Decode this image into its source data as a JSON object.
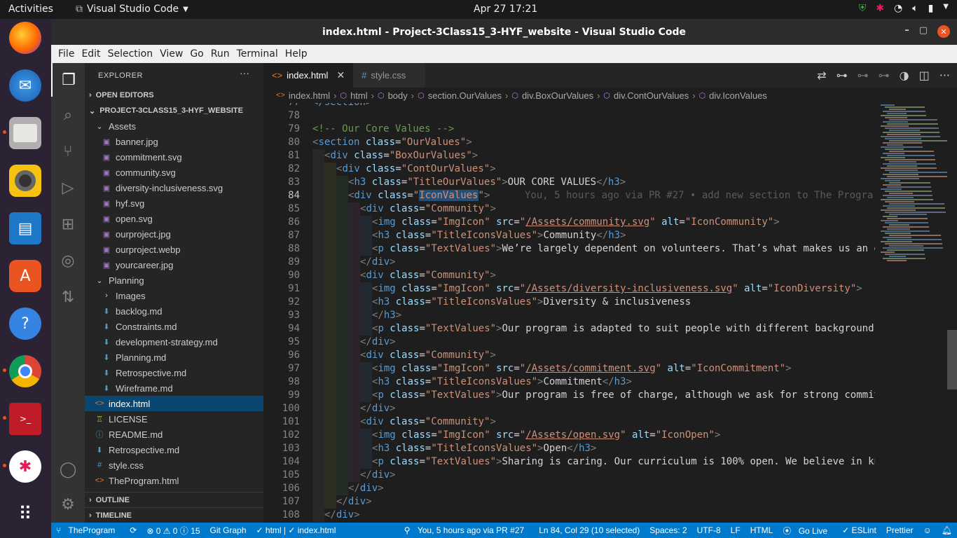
{
  "topbar": {
    "activities": "Activities",
    "app_name": "Visual Studio Code",
    "clock": "Apr 27  17:21"
  },
  "window": {
    "title": "index.html - Project-3Class15_3-HYF_website - Visual Studio Code"
  },
  "menu": [
    "File",
    "Edit",
    "Selection",
    "View",
    "Go",
    "Run",
    "Terminal",
    "Help"
  ],
  "sidebar": {
    "title": "EXPLORER",
    "open_editors": "OPEN EDITORS",
    "project": "PROJECT-3CLASS15_3-HYF_WEBSITE",
    "tree": [
      {
        "label": "Assets",
        "type": "folder",
        "depth": 1
      },
      {
        "label": "banner.jpg",
        "type": "img",
        "depth": 2
      },
      {
        "label": "commitment.svg",
        "type": "img",
        "depth": 2
      },
      {
        "label": "community.svg",
        "type": "img",
        "depth": 2
      },
      {
        "label": "diversity-inclusiveness.svg",
        "type": "img",
        "depth": 2
      },
      {
        "label": "hyf.svg",
        "type": "img",
        "depth": 2
      },
      {
        "label": "open.svg",
        "type": "img",
        "depth": 2
      },
      {
        "label": "ourproject.jpg",
        "type": "img",
        "depth": 2
      },
      {
        "label": "ourproject.webp",
        "type": "img",
        "depth": 2
      },
      {
        "label": "yourcareer.jpg",
        "type": "img",
        "depth": 2
      },
      {
        "label": "Planning",
        "type": "folder",
        "depth": 1
      },
      {
        "label": "Images",
        "type": "folder-closed",
        "depth": 2
      },
      {
        "label": "backlog.md",
        "type": "md",
        "depth": 2
      },
      {
        "label": "Constraints.md",
        "type": "md",
        "depth": 2
      },
      {
        "label": "development-strategy.md",
        "type": "md",
        "depth": 2
      },
      {
        "label": "Planning.md",
        "type": "md",
        "depth": 2
      },
      {
        "label": "Retrospective.md",
        "type": "md",
        "depth": 2
      },
      {
        "label": "Wireframe.md",
        "type": "md",
        "depth": 2
      },
      {
        "label": "index.html",
        "type": "html",
        "depth": 1,
        "selected": true
      },
      {
        "label": "LICENSE",
        "type": "lic",
        "depth": 1
      },
      {
        "label": "README.md",
        "type": "info",
        "depth": 1
      },
      {
        "label": "Retrospective.md",
        "type": "md",
        "depth": 1
      },
      {
        "label": "style.css",
        "type": "css",
        "depth": 1
      },
      {
        "label": "TheProgram.html",
        "type": "html",
        "depth": 1
      }
    ],
    "outline": "OUTLINE",
    "timeline": "TIMELINE"
  },
  "tabs": [
    {
      "label": "index.html",
      "active": true
    },
    {
      "label": "style.css",
      "active": false
    }
  ],
  "breadcrumb": [
    "index.html",
    "html",
    "body",
    "section.OurValues",
    "div.BoxOurValues",
    "div.ContOurValues",
    "div.IconValues"
  ],
  "editor": {
    "current_line": 84,
    "blame": "You, 5 hours ago via PR #27 • add new section to The Progra",
    "lines": [
      {
        "n": "77",
        "indent": 0,
        "html": "<span class='tg'>&lt;/section&gt;</span>"
      },
      {
        "n": "78",
        "indent": 0,
        "html": ""
      },
      {
        "n": "79",
        "indent": 0,
        "html": "<span class='cm'>&lt;!-- Our Core Values --&gt;</span>"
      },
      {
        "n": "80",
        "indent": 0,
        "html": "<span class='t'>&lt;</span><span class='tg'>section</span> <span class='at'>class</span><span class='tx'>=</span><span class='st'>\"OurValues\"</span><span class='t'>&gt;</span>"
      },
      {
        "n": "81",
        "indent": 1,
        "html": "<span class='t'>&lt;</span><span class='tg'>div</span> <span class='at'>class</span><span class='tx'>=</span><span class='st'>\"BoxOurValues\"</span><span class='t'>&gt;</span>"
      },
      {
        "n": "82",
        "indent": 2,
        "html": "<span class='t'>&lt;</span><span class='tg'>div</span> <span class='at'>class</span><span class='tx'>=</span><span class='st'>\"ContOurValues\"</span><span class='t'>&gt;</span>"
      },
      {
        "n": "83",
        "indent": 3,
        "html": "<span class='t'>&lt;</span><span class='tg'>h3</span> <span class='at'>class</span><span class='tx'>=</span><span class='st'>\"TitleOurValues\"</span><span class='t'>&gt;</span><span class='tx'>OUR CORE VALUES</span><span class='t'>&lt;/</span><span class='tg'>h3</span><span class='t'>&gt;</span>"
      },
      {
        "n": "84",
        "indent": 3,
        "html": "<span class='t'>&lt;</span><span class='tg'>div</span> <span class='at'>class</span><span class='tx'>=</span><span class='st'>\"<span class='sel'>IconValues</span>\"</span><span class='t'>&gt;</span>"
      },
      {
        "n": "85",
        "indent": 4,
        "html": "<span class='t'>&lt;</span><span class='tg'>div</span> <span class='at'>class</span><span class='tx'>=</span><span class='st'>\"Community\"</span><span class='t'>&gt;</span>"
      },
      {
        "n": "86",
        "indent": 5,
        "html": "<span class='t'>&lt;</span><span class='tg'>img</span> <span class='at'>class</span><span class='tx'>=</span><span class='st'>\"ImgIcon\"</span> <span class='at'>src</span><span class='tx'>=</span><span class='st'>\"<span class='ul'>/Assets/community.svg</span>\"</span> <span class='at'>alt</span><span class='tx'>=</span><span class='st'>\"IconCommunity\"</span><span class='t'>&gt;</span>"
      },
      {
        "n": "87",
        "indent": 5,
        "html": "<span class='t'>&lt;</span><span class='tg'>h3</span> <span class='at'>class</span><span class='tx'>=</span><span class='st'>\"TitleIconsValues\"</span><span class='t'>&gt;</span><span class='tx'>Community</span><span class='t'>&lt;/</span><span class='tg'>h3</span><span class='t'>&gt;</span>"
      },
      {
        "n": "88",
        "indent": 5,
        "html": "<span class='t'>&lt;</span><span class='tg'>p</span> <span class='at'>class</span><span class='tx'>=</span><span class='st'>\"TextValues\"</span><span class='t'>&gt;</span><span class='tx'>We’re largely dependent on volunteers. That’s what makes us an e</span>"
      },
      {
        "n": "89",
        "indent": 4,
        "html": "<span class='t'>&lt;/</span><span class='tg'>div</span><span class='t'>&gt;</span>"
      },
      {
        "n": "90",
        "indent": 4,
        "html": "<span class='t'>&lt;</span><span class='tg'>div</span> <span class='at'>class</span><span class='tx'>=</span><span class='st'>\"Community\"</span><span class='t'>&gt;</span>"
      },
      {
        "n": "91",
        "indent": 5,
        "html": "<span class='t'>&lt;</span><span class='tg'>img</span> <span class='at'>class</span><span class='tx'>=</span><span class='st'>\"ImgIcon\"</span> <span class='at'>src</span><span class='tx'>=</span><span class='st'>\"<span class='ul'>/Assets/diversity-inclusiveness.svg</span>\"</span> <span class='at'>alt</span><span class='tx'>=</span><span class='st'>\"IconDiversity\"</span><span class='t'>&gt;</span>"
      },
      {
        "n": "92",
        "indent": 5,
        "html": "<span class='t'>&lt;</span><span class='tg'>h3</span> <span class='at'>class</span><span class='tx'>=</span><span class='st'>\"TitleIconsValues\"</span><span class='t'>&gt;</span><span class='tx'>Diversity &amp; inclusiveness</span>"
      },
      {
        "n": "93",
        "indent": 5,
        "html": "<span class='t'>&lt;/</span><span class='tg'>h3</span><span class='t'>&gt;</span>"
      },
      {
        "n": "94",
        "indent": 5,
        "html": "<span class='t'>&lt;</span><span class='tg'>p</span> <span class='at'>class</span><span class='tx'>=</span><span class='st'>\"TextValues\"</span><span class='t'>&gt;</span><span class='tx'>Our program is adapted to suit people with different backgrounds</span>"
      },
      {
        "n": "95",
        "indent": 4,
        "html": "<span class='t'>&lt;/</span><span class='tg'>div</span><span class='t'>&gt;</span>"
      },
      {
        "n": "96",
        "indent": 4,
        "html": "<span class='t'>&lt;</span><span class='tg'>div</span> <span class='at'>class</span><span class='tx'>=</span><span class='st'>\"Community\"</span><span class='t'>&gt;</span>"
      },
      {
        "n": "97",
        "indent": 5,
        "html": "<span class='t'>&lt;</span><span class='tg'>img</span> <span class='at'>class</span><span class='tx'>=</span><span class='st'>\"ImgIcon\"</span> <span class='at'>src</span><span class='tx'>=</span><span class='st'>\"<span class='ul'>/Assets/commitment.svg</span>\"</span> <span class='at'>alt</span><span class='tx'>=</span><span class='st'>\"IconCommitment\"</span><span class='t'>&gt;</span>"
      },
      {
        "n": "98",
        "indent": 5,
        "html": "<span class='t'>&lt;</span><span class='tg'>h3</span> <span class='at'>class</span><span class='tx'>=</span><span class='st'>\"TitleIconsValues\"</span><span class='t'>&gt;</span><span class='tx'>Commitment</span><span class='t'>&lt;/</span><span class='tg'>h3</span><span class='t'>&gt;</span>"
      },
      {
        "n": "99",
        "indent": 5,
        "html": "<span class='t'>&lt;</span><span class='tg'>p</span> <span class='at'>class</span><span class='tx'>=</span><span class='st'>\"TextValues\"</span><span class='t'>&gt;</span><span class='tx'>Our program is free of charge, although we ask for strong commit</span>"
      },
      {
        "n": "100",
        "indent": 4,
        "html": "<span class='t'>&lt;/</span><span class='tg'>div</span><span class='t'>&gt;</span>"
      },
      {
        "n": "101",
        "indent": 4,
        "html": "<span class='t'>&lt;</span><span class='tg'>div</span> <span class='at'>class</span><span class='tx'>=</span><span class='st'>\"Community\"</span><span class='t'>&gt;</span>"
      },
      {
        "n": "102",
        "indent": 5,
        "html": "<span class='t'>&lt;</span><span class='tg'>img</span> <span class='at'>class</span><span class='tx'>=</span><span class='st'>\"ImgIcon\"</span> <span class='at'>src</span><span class='tx'>=</span><span class='st'>\"<span class='ul'>/Assets/open.svg</span>\"</span> <span class='at'>alt</span><span class='tx'>=</span><span class='st'>\"IconOpen\"</span><span class='t'>&gt;</span>"
      },
      {
        "n": "103",
        "indent": 5,
        "html": "<span class='t'>&lt;</span><span class='tg'>h3</span> <span class='at'>class</span><span class='tx'>=</span><span class='st'>\"TitleIconsValues\"</span><span class='t'>&gt;</span><span class='tx'>Open</span><span class='t'>&lt;/</span><span class='tg'>h3</span><span class='t'>&gt;</span>"
      },
      {
        "n": "104",
        "indent": 5,
        "html": "<span class='t'>&lt;</span><span class='tg'>p</span> <span class='at'>class</span><span class='tx'>=</span><span class='st'>\"TextValues\"</span><span class='t'>&gt;</span><span class='tx'>Sharing is caring. Our curriculum is 100% open. We believe in kn</span>"
      },
      {
        "n": "105",
        "indent": 4,
        "html": "<span class='t'>&lt;/</span><span class='tg'>div</span><span class='t'>&gt;</span>"
      },
      {
        "n": "106",
        "indent": 3,
        "html": "<span class='t'>&lt;/</span><span class='tg'>div</span><span class='t'>&gt;</span>"
      },
      {
        "n": "107",
        "indent": 2,
        "html": "<span class='t'>&lt;/</span><span class='tg'>div</span><span class='t'>&gt;</span>"
      },
      {
        "n": "108",
        "indent": 1,
        "html": "<span class='t'>&lt;/</span><span class='tg'>div</span><span class='t'>&gt;</span>"
      }
    ]
  },
  "statusbar": {
    "branch": "TheProgram",
    "sync": "⟳",
    "problems": "⊗ 0 ⚠ 0 ⓘ 15",
    "git_graph": "Git Graph",
    "html_check": "✓ html | ✓ index.html",
    "blame": "You, 5 hours ago via PR #27",
    "position": "Ln 84, Col 29 (10 selected)",
    "spaces": "Spaces: 2",
    "encoding": "UTF-8",
    "eol": "LF",
    "language": "HTML",
    "golive": "Go Live",
    "eslint": "✓ ESLint",
    "prettier": "Prettier"
  },
  "colors": {
    "statusbar": "#007acc",
    "selected_row": "#094771",
    "dock": "#2b2233"
  }
}
